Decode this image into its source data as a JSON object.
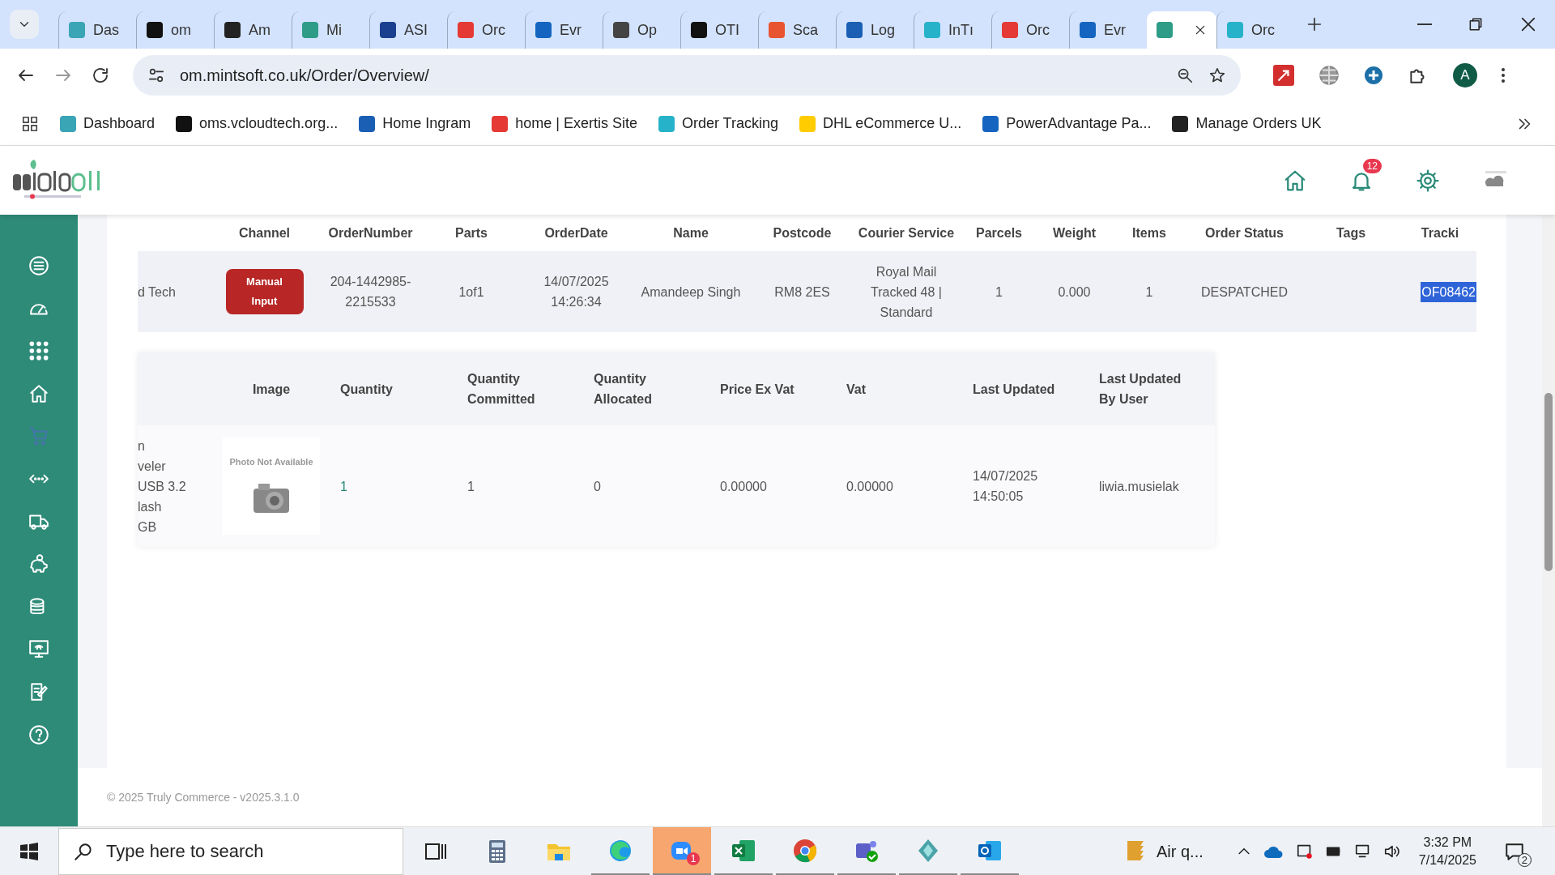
{
  "browser": {
    "tabs": [
      {
        "label": "Das",
        "color": "#3aa5b5",
        "selected": false
      },
      {
        "label": "om",
        "color": "#111111",
        "selected": false
      },
      {
        "label": "Am",
        "color": "#222222",
        "selected": false
      },
      {
        "label": "Mi",
        "color": "#2e9c86",
        "selected": false
      },
      {
        "label": "ASI",
        "color": "#1b3f8f",
        "selected": false
      },
      {
        "label": "Orc",
        "color": "#e53935",
        "selected": false
      },
      {
        "label": "Evr",
        "color": "#1565c0",
        "selected": false
      },
      {
        "label": "Op",
        "color": "#444444",
        "selected": false
      },
      {
        "label": "OTI",
        "color": "#111111",
        "selected": false
      },
      {
        "label": "Sca",
        "color": "#e8542f",
        "selected": false
      },
      {
        "label": "Log",
        "color": "#1a5fb4",
        "selected": false
      },
      {
        "label": "InTı",
        "color": "#26b3c9",
        "selected": false
      },
      {
        "label": "Orc",
        "color": "#e53935",
        "selected": false
      },
      {
        "label": "Evr",
        "color": "#1565c0",
        "selected": false
      },
      {
        "color": "#2e9c86",
        "selected": true
      },
      {
        "label": "Orc",
        "color": "#26b3c9",
        "selected": false
      }
    ],
    "address": "om.mintsoft.co.uk/Order/Overview/",
    "avatar": "A",
    "bookmarks": [
      {
        "label": "Dashboard",
        "color": "#3aa5b5"
      },
      {
        "label": "oms.vcloudtech.org...",
        "color": "#111111"
      },
      {
        "label": "Home Ingram",
        "color": "#1a5fb4"
      },
      {
        "label": "home | Exertis Site",
        "color": "#e53935"
      },
      {
        "label": "Order Tracking",
        "color": "#26b3c9"
      },
      {
        "label": "DHL eCommerce U...",
        "color": "#ffcc00"
      },
      {
        "label": "PowerAdvantage Pa...",
        "color": "#1565c0"
      },
      {
        "label": "Manage Orders UK",
        "color": "#222222"
      }
    ]
  },
  "header": {
    "notifications": "12"
  },
  "sidebar": {
    "items": [
      {
        "kind": "list",
        "selected": false
      },
      {
        "kind": "gauge",
        "selected": false
      },
      {
        "kind": "grid",
        "selected": false
      },
      {
        "kind": "home",
        "selected": false
      },
      {
        "kind": "cart",
        "selected": true
      },
      {
        "kind": "arrows",
        "selected": false
      },
      {
        "kind": "truck",
        "selected": false
      },
      {
        "kind": "piggy",
        "selected": false
      },
      {
        "kind": "coins",
        "selected": false
      },
      {
        "kind": "monitor",
        "selected": false
      },
      {
        "kind": "edit",
        "selected": false
      },
      {
        "kind": "help",
        "selected": false
      }
    ]
  },
  "orders": {
    "columns": [
      "",
      "Channel",
      "OrderNumber",
      "Parts",
      "OrderDate",
      "Name",
      "Postcode",
      "Courier Service",
      "Parcels",
      "Weight",
      "Items",
      "Order Status",
      "Tags",
      "Tracki"
    ],
    "row": [
      {
        "kind": "text",
        "text": "d Tech"
      },
      {
        "kind": "badge",
        "text": "Manual Input"
      },
      {
        "kind": "text",
        "text": "204-1442985-2215533"
      },
      {
        "kind": "text",
        "text": "1of1"
      },
      {
        "kind": "text",
        "text": "14/07/2025 14:26:34"
      },
      {
        "kind": "text",
        "text": "Amandeep Singh"
      },
      {
        "kind": "text",
        "text": "RM8 2ES"
      },
      {
        "kind": "text",
        "text": "Royal Mail Tracked 48 | Standard"
      },
      {
        "kind": "text",
        "text": "1"
      },
      {
        "kind": "text",
        "text": "0.000"
      },
      {
        "kind": "text",
        "text": "1"
      },
      {
        "kind": "text",
        "text": "DESPATCHED"
      },
      {
        "kind": "blank"
      },
      {
        "kind": "highlight",
        "text": "OF08462"
      }
    ]
  },
  "items": {
    "columns": [
      "Image",
      "Quantity",
      "Quantity Committed",
      "Quantity Allocated",
      "Price Ex Vat",
      "Vat",
      "Last Updated",
      "Last Updated By User"
    ],
    "row": {
      "description_lines": [
        "n",
        "veler",
        "USB 3.2",
        "lash",
        "GB"
      ],
      "image_text": "Photo Not Available",
      "quantity": "1",
      "committed": "1",
      "allocated": "0",
      "price": "0.00000",
      "vat": "0.00000",
      "last_updated": "14/07/2025 14:50:05",
      "user": "liwia.musielak"
    }
  },
  "footer": "© 2025 Truly Commerce - v2025.3.1.0",
  "taskbar": {
    "search": {
      "placeholder": "Type here to search"
    },
    "apps": [
      {
        "kind": "taskview",
        "running": false,
        "selected": false
      },
      {
        "kind": "calculator",
        "running": false,
        "selected": false
      },
      {
        "kind": "files",
        "running": false,
        "selected": false
      },
      {
        "kind": "edge",
        "running": true,
        "selected": false
      },
      {
        "kind": "zoom",
        "running": true,
        "selected": true,
        "badge": "1"
      },
      {
        "kind": "excel",
        "running": true,
        "selected": false
      },
      {
        "kind": "chrome",
        "running": true,
        "selected": false
      },
      {
        "kind": "teams",
        "running": true,
        "selected": false
      },
      {
        "kind": "app",
        "running": true,
        "selected": false
      },
      {
        "kind": "outlook",
        "running": true,
        "selected": false
      }
    ],
    "weather": "Air q...",
    "time": "3:32 PM",
    "date": "7/14/2025",
    "notifications": "2"
  }
}
